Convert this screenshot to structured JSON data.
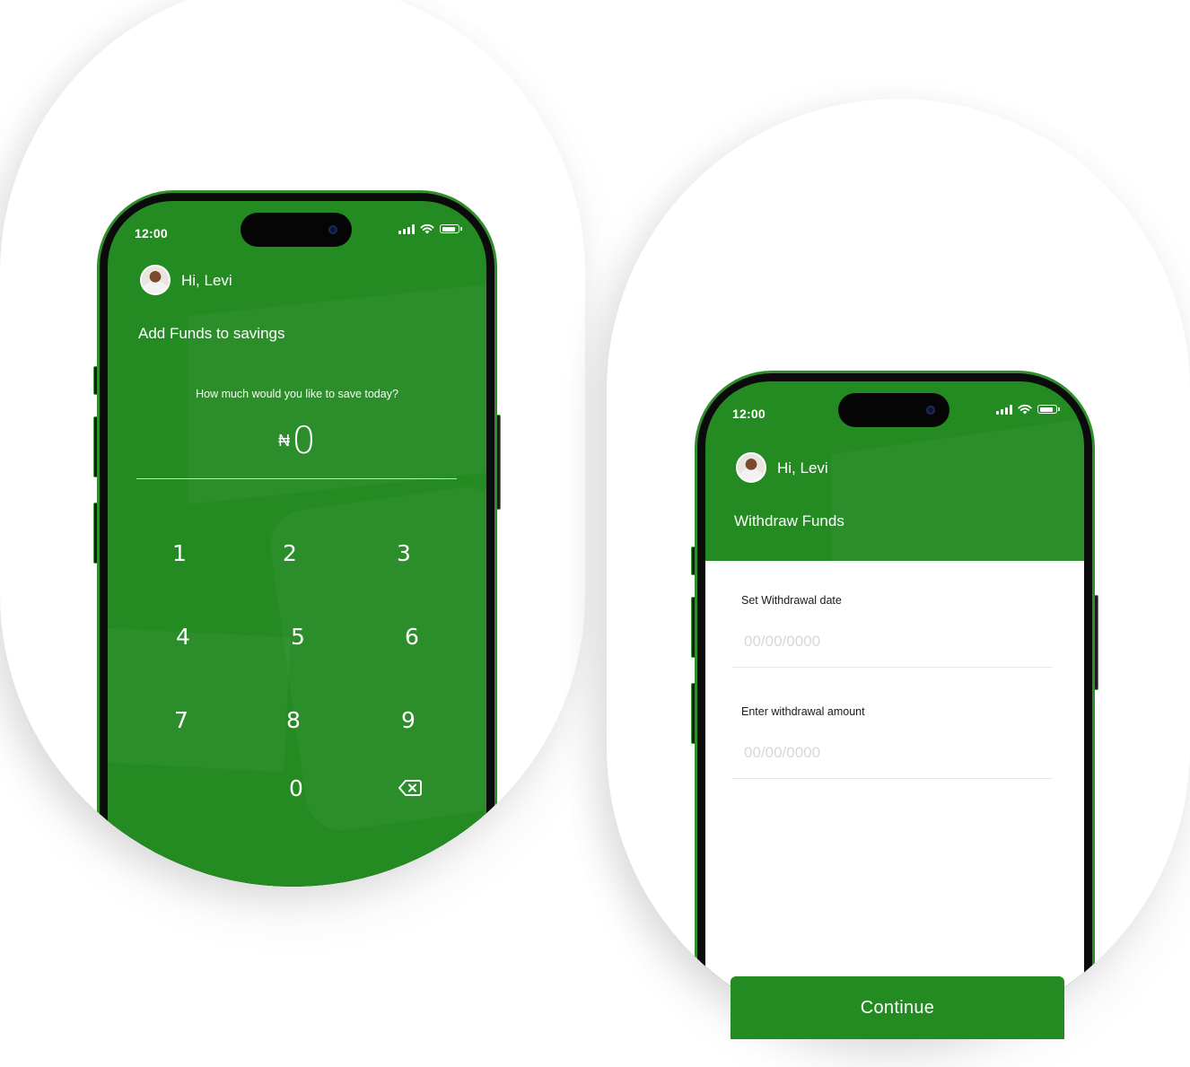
{
  "colors": {
    "brand_green": "#248a22",
    "frame_green": "#2f8f2a",
    "white": "#ffffff"
  },
  "left_screen": {
    "status_time": "12:00",
    "greeting": "Hi, Levi",
    "title": "Add Funds to savings",
    "prompt": "How much would you like to save today?",
    "currency_symbol": "₦",
    "amount": "0",
    "keypad": [
      "1",
      "2",
      "3",
      "4",
      "5",
      "6",
      "7",
      "8",
      "9",
      "0"
    ],
    "icons": {
      "backspace": "backspace-icon",
      "wifi": "wifi-icon",
      "signal": "signal-icon",
      "battery": "battery-icon"
    }
  },
  "right_screen": {
    "status_time": "12:00",
    "greeting": "Hi, Levi",
    "title": "Withdraw Funds",
    "date_label": "Set Withdrawal date",
    "date_placeholder": "00/00/0000",
    "amount_label": "Enter withdrawal amount",
    "amount_placeholder": "00/00/0000",
    "continue_label": "Continue"
  }
}
